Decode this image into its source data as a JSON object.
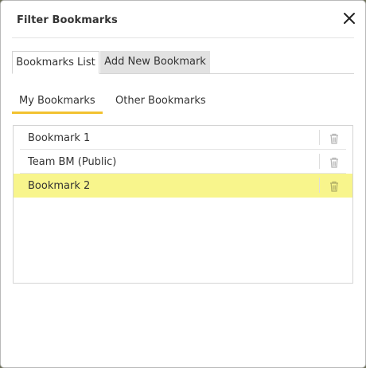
{
  "dialog": {
    "title": "Filter Bookmarks",
    "close_icon": "close-icon"
  },
  "tabs": [
    {
      "label": "Bookmarks List",
      "active": true
    },
    {
      "label": "Add New Bookmark",
      "active": false
    }
  ],
  "subtabs": [
    {
      "label": "My Bookmarks",
      "active": true
    },
    {
      "label": "Other Bookmarks",
      "active": false
    }
  ],
  "bookmarks": [
    {
      "label": "Bookmark 1",
      "selected": false,
      "action_icon": "trash-icon"
    },
    {
      "label": "Team BM (Public)",
      "selected": false,
      "action_icon": "trash-icon"
    },
    {
      "label": "Bookmark 2",
      "selected": true,
      "action_icon": "trash-icon"
    }
  ],
  "colors": {
    "selected_row": "#f8f58c",
    "active_subtab_underline": "#f2c230",
    "inactive_tab_bg": "#e2e2e2"
  }
}
